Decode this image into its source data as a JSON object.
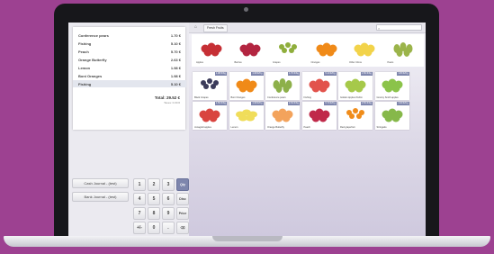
{
  "order": {
    "lines": [
      {
        "name": "Conference pears",
        "price": "1.70 €"
      },
      {
        "name": "Fishing",
        "price": "5.10 €"
      },
      {
        "name": "Peach",
        "price": "5.70 €"
      },
      {
        "name": "Orange Butterfly",
        "price": "2.63 €"
      },
      {
        "name": "Lemon",
        "price": "1.98 €"
      },
      {
        "name": "Boni Oranges",
        "price": "1.98 €"
      },
      {
        "name": "Fishing",
        "price": "5.10 €"
      }
    ],
    "total_label": "Total: 29.52 €",
    "taxes_label": "Taxes: 0.00 €"
  },
  "payments": [
    "Cash Journal - (test)",
    "Bank Journal - (test)"
  ],
  "numpad": {
    "keys": [
      "1",
      "2",
      "3",
      "Qty",
      "4",
      "5",
      "6",
      "Disc",
      "7",
      "8",
      "9",
      "Price",
      "+/-",
      "0",
      ".",
      "⌫"
    ],
    "active_index": 3
  },
  "breadcrumb": {
    "home_icon": "home-icon",
    "category": "Fresh Fruits"
  },
  "search": {
    "placeholder": "Search Products"
  },
  "categories": [
    {
      "label": "Apples",
      "icon": "apples-icon"
    },
    {
      "label": "Berries",
      "icon": "berries-icon"
    },
    {
      "label": "Grapes",
      "icon": "grapes-icon"
    },
    {
      "label": "Oranges",
      "icon": "oranges-icon"
    },
    {
      "label": "Other Citrus",
      "icon": "citrus-icon"
    },
    {
      "label": "Pears",
      "icon": "pears-icon"
    }
  ],
  "products": [
    {
      "label": "Black Grapes",
      "price": "1.98 €/Kg",
      "icon": "grapes-icon",
      "color": "#3b3b5a"
    },
    {
      "label": "Boni Oranges",
      "price": "1.98 €/Kg",
      "icon": "orange-icon",
      "color": "#f08a18"
    },
    {
      "label": "Conference pears",
      "price": "1.70 €/Kg",
      "icon": "pear-icon",
      "color": "#8db04a"
    },
    {
      "label": "Fishing",
      "price": "5.10 €/Kg",
      "icon": "peach-icon",
      "color": "#e2534c"
    },
    {
      "label": "Golden Apples Perlim",
      "price": "1.50 €/Kg",
      "icon": "apple-icon",
      "color": "#a6c94a"
    },
    {
      "label": "Granny Smith apples",
      "price": "1.80 €/Kg",
      "icon": "apple-icon",
      "color": "#8bc34a"
    },
    {
      "label": "Jonagold apples",
      "price": "1.50 €/Kg",
      "icon": "apple-icon",
      "color": "#d9443f"
    },
    {
      "label": "Lemon",
      "price": "1.98 €/Kg",
      "icon": "lemon-icon",
      "color": "#f0dd5a"
    },
    {
      "label": "Orange Butterfly",
      "price": "2.63 €/Kg",
      "icon": "orange-icon",
      "color": "#f3a35c"
    },
    {
      "label": "Peach",
      "price": "5.70 €/Kg",
      "icon": "peach-icon",
      "color": "#c02a4a"
    },
    {
      "label": "Red grapefruit",
      "price": "2.50 €/Kg",
      "icon": "grapefruit-icon",
      "color": "#f08c1a"
    },
    {
      "label": "Stringatto",
      "price": "1.90 €/Kg",
      "icon": "apple-icon",
      "color": "#86b84a"
    }
  ]
}
